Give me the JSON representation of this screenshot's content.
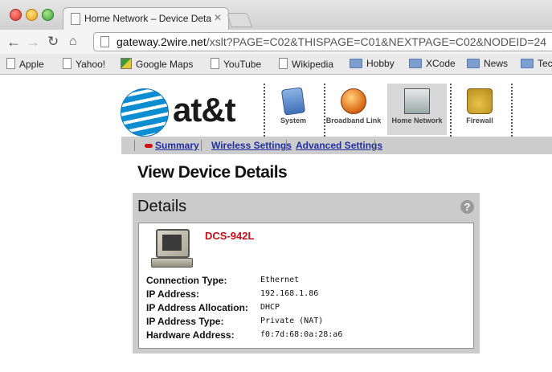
{
  "browser": {
    "tab_title": "Home Network – Device Details",
    "url_host": "gateway.2wire.net",
    "url_path": "/xslt?PAGE=C02&THISPAGE=C01&NEXTPAGE=C02&NODEID=24",
    "bookmarks": [
      "Apple",
      "Yahoo!",
      "Google Maps",
      "YouTube",
      "Wikipedia",
      "Hobby",
      "XCode",
      "News",
      "Tec"
    ]
  },
  "logo": {
    "text": "at&t",
    "globe_colors": [
      "#0d8dd1",
      "#ffffff"
    ]
  },
  "nav": {
    "tabs": [
      {
        "label": "System",
        "icon": "system-icon"
      },
      {
        "label": "Broadband Link",
        "icon": "broadband-icon"
      },
      {
        "label": "Home Network",
        "icon": "home-network-icon",
        "active": true
      },
      {
        "label": "Firewall",
        "icon": "firewall-icon"
      }
    ]
  },
  "subnav": {
    "links": [
      "Summary",
      "Wireless Settings",
      "Advanced Settings"
    ]
  },
  "page": {
    "title": "View Device Details"
  },
  "details": {
    "heading": "Details",
    "help": "?",
    "device_name": "DCS-942L",
    "rows": [
      {
        "label": "Connection Type:",
        "value": "Ethernet"
      },
      {
        "label": "IP Address:",
        "value": "192.168.1.86"
      },
      {
        "label": "IP Address Allocation:",
        "value": "DHCP"
      },
      {
        "label": "IP Address Type:",
        "value": "Private (NAT)"
      },
      {
        "label": "Hardware Address:",
        "value": "f0:7d:68:0a:28:a6"
      }
    ]
  },
  "colors": {
    "link": "#1f2fa0",
    "device_name": "#c0101a",
    "panel_bg": "#cbcbcb"
  }
}
